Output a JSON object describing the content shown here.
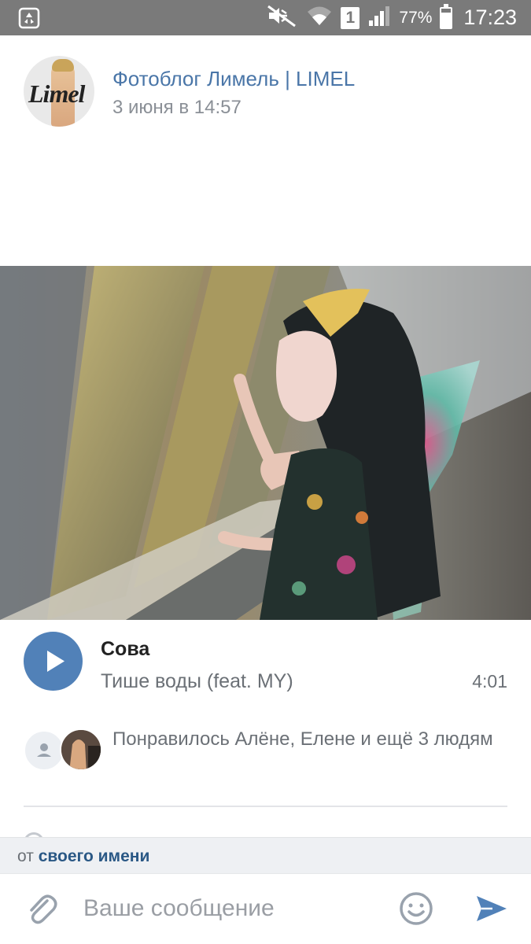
{
  "status_bar": {
    "battery_percent": "77%",
    "battery_level": 0.77,
    "sim_slot": "1",
    "time": "17:23",
    "icons": [
      "recycle-icon",
      "mute-icon",
      "wifi-icon",
      "signal-icon",
      "battery-icon"
    ]
  },
  "post": {
    "author": "Фотоблог Лимель | LIMEL",
    "avatar_text": "Limel",
    "date": "3 июня в 14:57"
  },
  "audio": {
    "artist": "Сова",
    "title": "Тише воды (feat. MY)",
    "duration": "4:01"
  },
  "likes": {
    "text": "Понравилось Алёне, Елене и ещё 3 людям"
  },
  "composer": {
    "from_prefix": "от",
    "from_link": "своего имени",
    "placeholder": "Ваше сообщение"
  },
  "colors": {
    "accent": "#5181b8",
    "link": "#4a76a8",
    "status_bar": "#7a7a7a"
  }
}
